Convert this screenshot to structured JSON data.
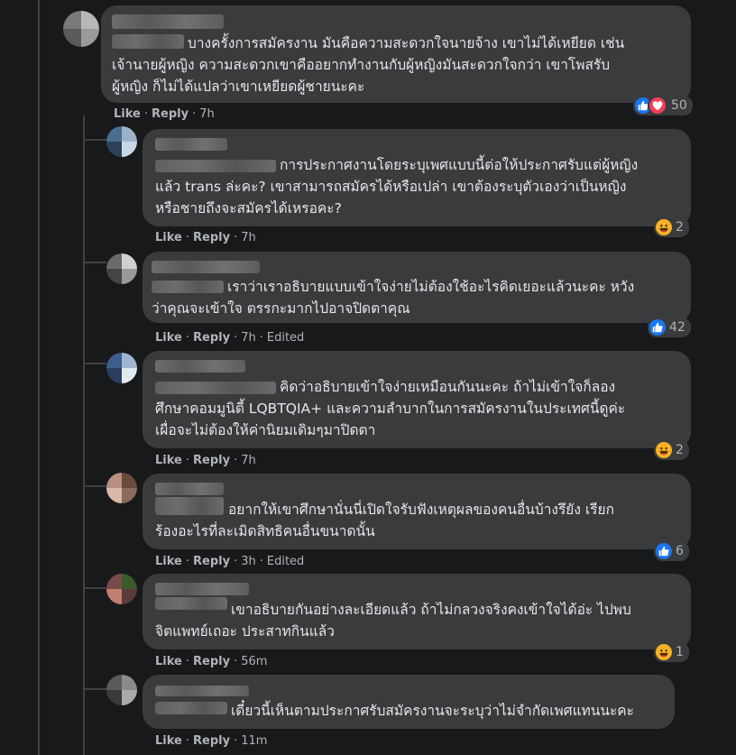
{
  "comments": [
    {
      "text_lines": [
        "บางครั้งการสมัครงาน มันคือความสะดวกใจนายจ้าง เขาไม่ได้เหยียด เช่น",
        "เจ้านายผู้หญิง ความสะดวกเขาคืออยากทำงานกับผู้หญิงมันสะดวกใจกว่า เขาโพสรับ",
        "ผู้หญิง ก็ไม่ได้แปลว่าเขาเหยียดผู้ชายนะคะ"
      ],
      "like": "Like",
      "reply": "Reply",
      "time": "7h",
      "edited": "",
      "reaction_icons": [
        "like-icon",
        "love-icon"
      ],
      "reaction_count": "50"
    },
    {
      "text_lines": [
        "การประกาศงานโดยระบุเพศแบบนี้ต่อให้ประกาศรับแต่ผู้หญิง",
        "แล้ว trans ล่ะคะ? เขาสามารถสมัครได้หรือเปล่า เขาต้องระบุตัวเองว่าเป็นหญิง",
        "หรือชายถึงจะสมัครได้เหรอคะ?"
      ],
      "like": "Like",
      "reply": "Reply",
      "time": "7h",
      "edited": "",
      "reaction_icons": [
        "haha-icon"
      ],
      "reaction_count": "2"
    },
    {
      "text_lines": [
        "เราว่าเราอธิบายแบบเข้าใจง่ายไม่ต้องใช้อะไรคิดเยอะแล้วนะคะ หวัง",
        "ว่าคุณจะเข้าใจ ตรรกะมากไปอาจปิดตาคุณ"
      ],
      "like": "Like",
      "reply": "Reply",
      "time": "7h",
      "edited": "Edited",
      "reaction_icons": [
        "like-icon"
      ],
      "reaction_count": "42"
    },
    {
      "text_lines": [
        "คิดว่าอธิบายเข้าใจง่ายเหมือนกันนะคะ ถ้าไม่เข้าใจก็ลอง",
        "ศึกษาคอมมูนิตี้ LQBTQIA+ และความลำบากในการสมัครงานในประเทศนี้ดูค่ะ",
        "เผื่อจะไม่ต้องให้ค่านิยมเดิมๆมาปิดตา"
      ],
      "like": "Like",
      "reply": "Reply",
      "time": "7h",
      "edited": "",
      "reaction_icons": [
        "haha-icon"
      ],
      "reaction_count": "2"
    },
    {
      "text_lines": [
        "อยากให้เขาศึกษานั่นนี่เปิดใจรับฟังเหตุผลของคนอื่นบ้างรึยัง เรียก",
        "ร้องอะไรที่ละเมิดสิทธิคนอื่นขนาดนั้น"
      ],
      "like": "Like",
      "reply": "Reply",
      "time": "3h",
      "edited": "Edited",
      "reaction_icons": [
        "like-icon"
      ],
      "reaction_count": "6"
    },
    {
      "text_lines": [
        "เขาอธิบายกันอย่างละเอียดแล้ว ถ้าไม่กลวงจริงคงเข้าใจได้อ่ะ ไปพบ",
        "จิตแพทย์เถอะ ประสาทกินแล้ว"
      ],
      "like": "Like",
      "reply": "Reply",
      "time": "56m",
      "edited": "",
      "reaction_icons": [
        "haha-icon"
      ],
      "reaction_count": "1"
    },
    {
      "text_lines": [
        "เดี๋ยวนี้เห็นตามประกาศรับสมัครงานจะระบุว่าไม่จำกัดเพศแทนนะคะ"
      ],
      "like": "Like",
      "reply": "Reply",
      "time": "11m",
      "edited": "",
      "reaction_icons": [],
      "reaction_count": ""
    }
  ]
}
